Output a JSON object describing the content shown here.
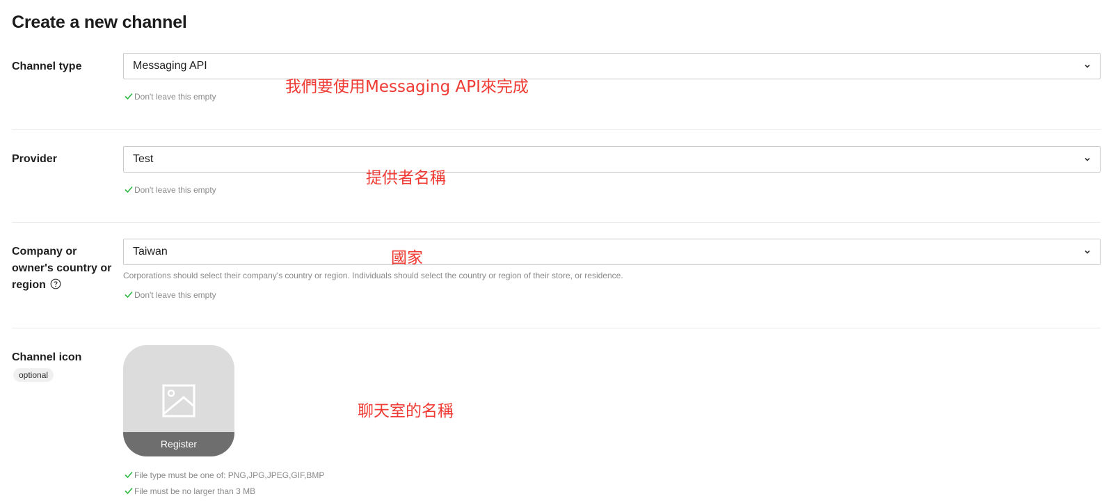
{
  "page": {
    "title": "Create a new channel"
  },
  "fields": {
    "channel_type": {
      "label": "Channel type",
      "value": "Messaging API",
      "validation": "Don't leave this empty",
      "annotation": "我們要使用Messaging API來完成"
    },
    "provider": {
      "label": "Provider",
      "value": "Test",
      "validation": "Don't leave this empty",
      "annotation": "提供者名稱"
    },
    "country": {
      "label_line1": "Company or",
      "label_line2": "owner's country or",
      "label_line3": "region",
      "value": "Taiwan",
      "helper": "Corporations should select their company's country or region. Individuals should select the country or region of their store, or residence.",
      "validation": "Don't leave this empty",
      "annotation": "國家"
    },
    "channel_icon": {
      "label": "Channel icon",
      "badge": "optional",
      "register_label": "Register",
      "rule_file_type": "File type must be one of: PNG,JPG,JPEG,GIF,BMP",
      "rule_file_size": "File must be no larger than 3 MB",
      "annotation": "聊天室的名稱"
    }
  },
  "icons": {
    "dropdown": "chevron-down-icon",
    "valid": "check-icon",
    "help": "question-circle-icon",
    "image": "image-placeholder-icon"
  },
  "colors": {
    "annotation": "#ef3b33",
    "valid_check": "#2db742",
    "register_bar": "#6e6e6e",
    "upload_bg": "#dcdcdc"
  }
}
